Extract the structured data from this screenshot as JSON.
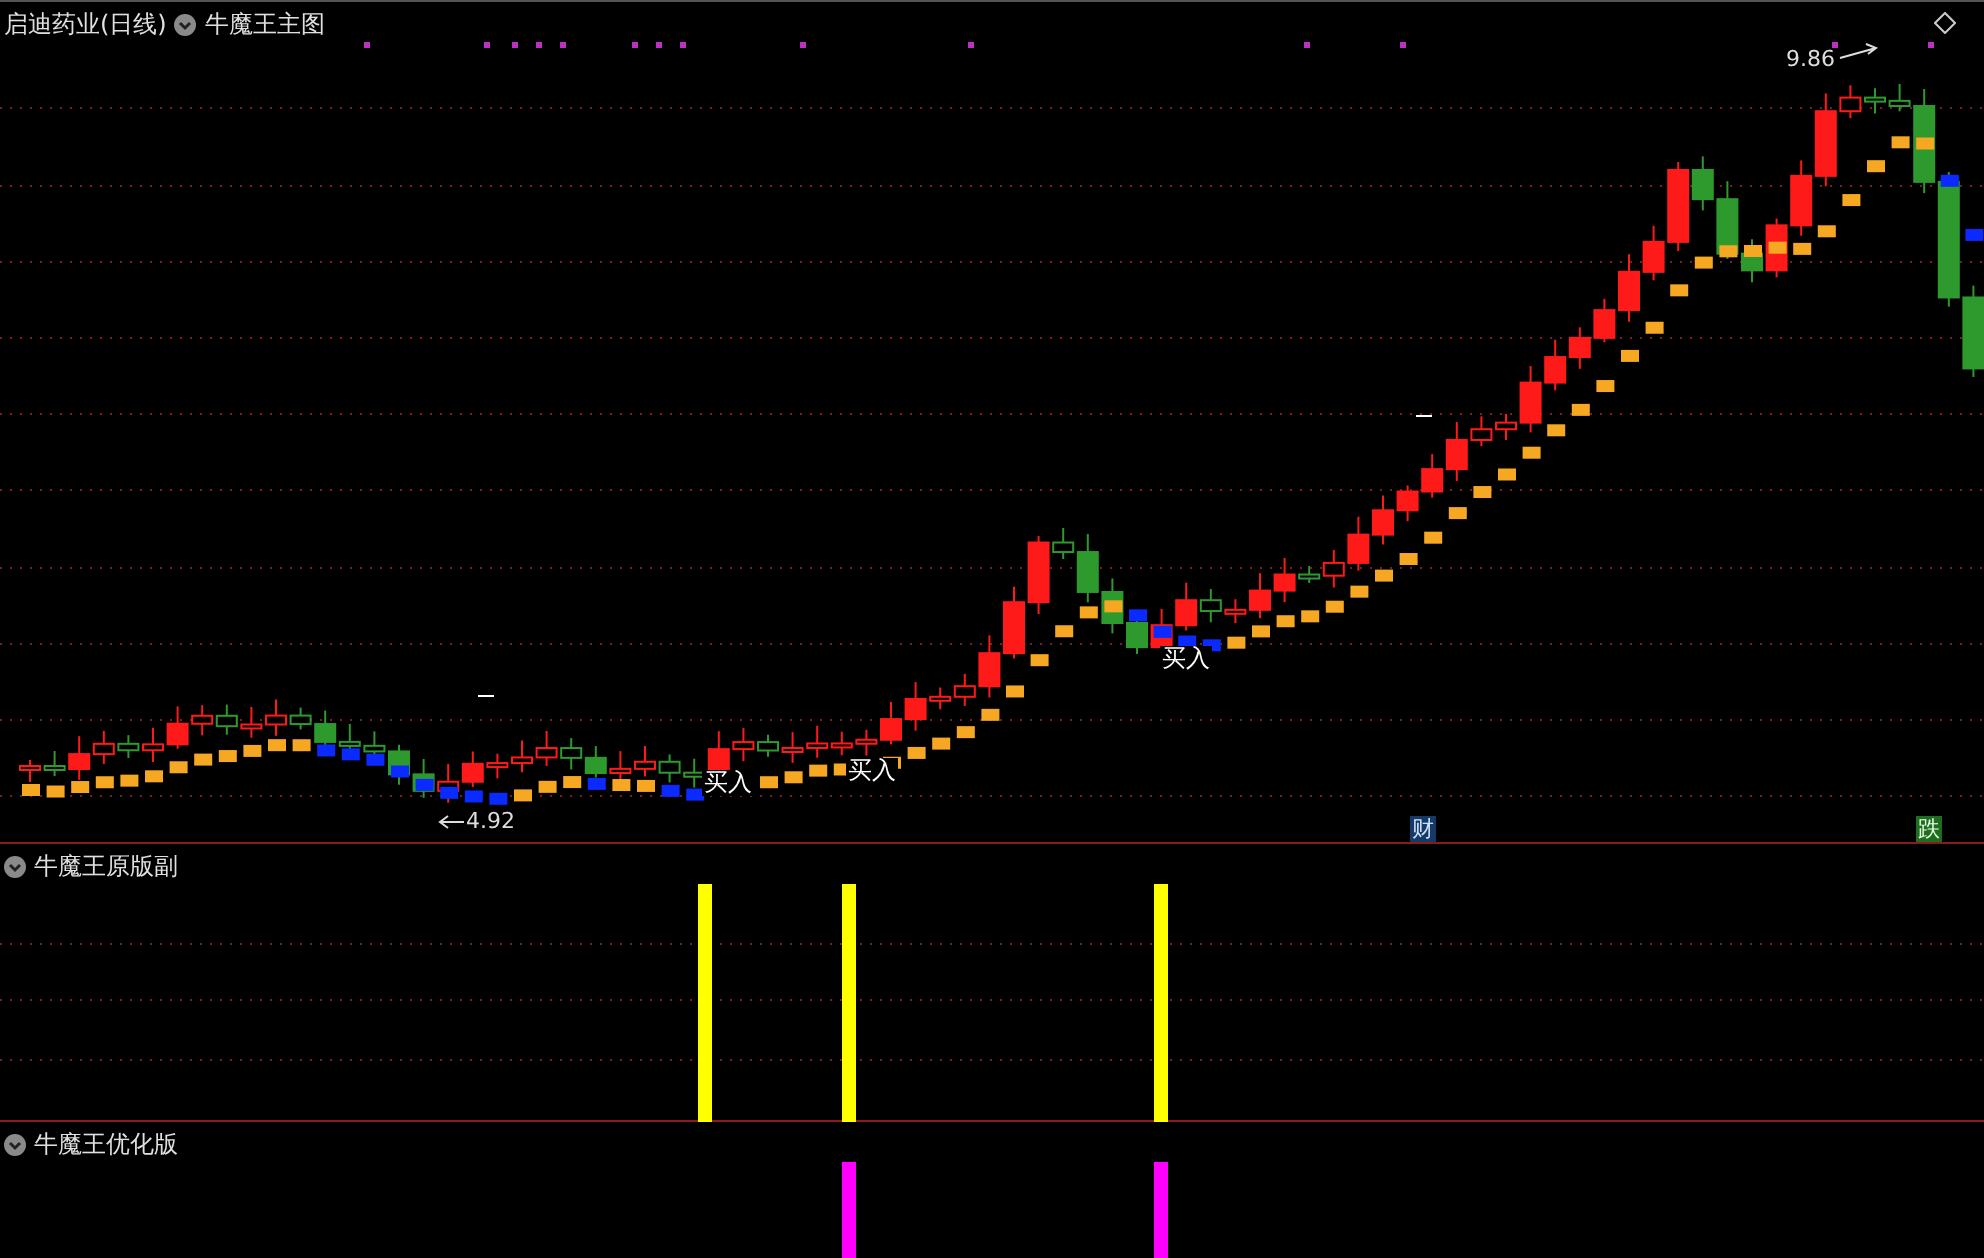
{
  "main_chart": {
    "stock_title": "启迪药业(日线)",
    "indicator_title": "牛魔王主图",
    "high_label": "9.86",
    "low_label": "4.92",
    "signals": [
      {
        "text": "买入"
      },
      {
        "text": "买入"
      },
      {
        "text": "买入"
      }
    ],
    "badges": [
      {
        "text": "财",
        "kind": "finance"
      },
      {
        "text": "跌",
        "kind": "fall"
      }
    ]
  },
  "sub_panels": [
    {
      "title": "牛魔王原版副"
    },
    {
      "title": "牛魔王优化版"
    }
  ]
}
